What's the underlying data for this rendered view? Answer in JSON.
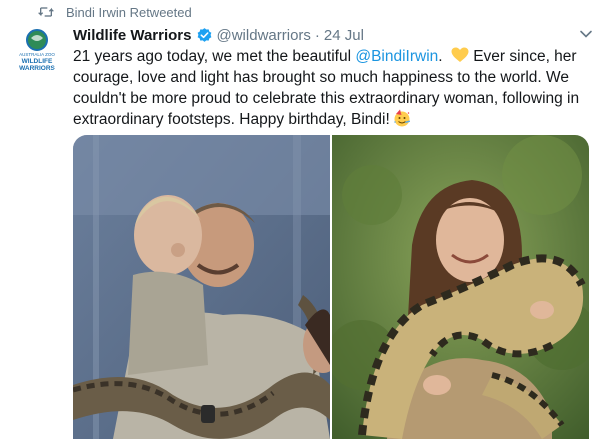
{
  "retweet": {
    "text": "Bindi Irwin Retweeted"
  },
  "account": {
    "display_name": "Wildlife Warriors",
    "handle": "@wildwarriors",
    "separator": "·",
    "date": "24 Jul",
    "logo_text": [
      "AUSTRALIA ZOO",
      "WILDLIFE",
      "WARRIORS"
    ]
  },
  "tweet": {
    "text_before": "21 years ago today, we met the beautiful ",
    "mention": "@BindiIrwin",
    "text_after": ". ",
    "text_rest": " Ever since, her courage, love and light has brought so much happiness to the world. We couldn't be more proud to celebrate this extraordinary woman, following in extraordinary footsteps. Happy birthday, Bindi!",
    "emoji": [
      "yellow-heart",
      "party-face"
    ]
  },
  "media": {
    "photos": [
      "black-and-white photo of father holding toddler with python",
      "young woman holding python in garden"
    ]
  },
  "colors": {
    "accent": "#1b95e0",
    "secondary_text": "#657786",
    "verified": "#1da1f2",
    "heart": "#ffcc4d"
  }
}
